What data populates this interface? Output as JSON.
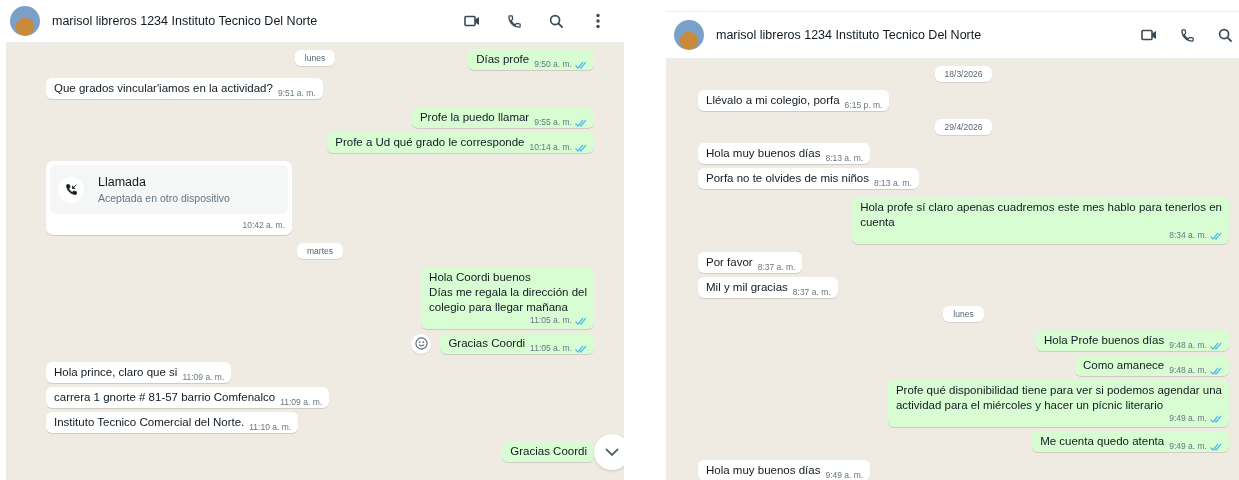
{
  "panels": [
    {
      "contact": {
        "name": "marisol libreros 1234 Instituto Tecnico Del Norte"
      },
      "actions": [
        {
          "kind": "video"
        },
        {
          "kind": "phone"
        },
        {
          "kind": "search"
        },
        {
          "kind": "menu"
        }
      ],
      "scroll_down_button": true,
      "items": [
        {
          "kind": "date",
          "text": "lunes",
          "sticky": true
        },
        {
          "kind": "sent",
          "text": "Días profe",
          "time": "9:50 a. m.",
          "read": true
        },
        {
          "kind": "received",
          "text": "Que grados vincular'iamos en la actividad?",
          "time": "9:51 a. m."
        },
        {
          "kind": "sent",
          "text": "Profe la puedo llamar",
          "time": "9:55 a. m.",
          "read": true
        },
        {
          "kind": "sent",
          "text": "Profe a Ud qué grado le corresponde",
          "time": "10:14 a. m.",
          "read": true
        },
        {
          "kind": "call",
          "title": "Llamada",
          "subtitle": "Aceptada en otro dispositivo",
          "time": "10:42 a. m."
        },
        {
          "kind": "date",
          "text": "martes",
          "sticky": false
        },
        {
          "kind": "sent",
          "text": "Hola Coordi buenos\nDías me regala la dirección del\ncolegio para llegar mañana",
          "time": "11:05 a. m.",
          "read": true
        },
        {
          "kind": "sent",
          "text": "Gracias Coordi",
          "time": "11:05 a. m.",
          "read": true,
          "reaction_button": true
        },
        {
          "kind": "received",
          "text": "Hola prince, claro que si",
          "time": "11:09 a. m."
        },
        {
          "kind": "received",
          "text": "carrera 1 gnorte # 81-57 barrio Comfenalco",
          "time": "11:09 a. m."
        },
        {
          "kind": "received",
          "text": "Instituto Tecnico Comercial del Norte.",
          "time": "11:10 a. m."
        },
        {
          "kind": "sent",
          "text": "Gracias Coordi"
        }
      ]
    },
    {
      "contact": {
        "name": "marisol libreros 1234 Instituto Tecnico Del Norte"
      },
      "actions": [
        {
          "kind": "video"
        },
        {
          "kind": "phone"
        },
        {
          "kind": "search"
        }
      ],
      "items": [
        {
          "kind": "date",
          "text": "18/3/2026",
          "sticky": false
        },
        {
          "kind": "received",
          "text": "Llévalo a mi colegio, porfa",
          "time": "6:15 p. m."
        },
        {
          "kind": "date",
          "text": "29/4/2026",
          "sticky": false
        },
        {
          "kind": "received",
          "text": "Hola muy buenos días",
          "time": "8:13 a. m."
        },
        {
          "kind": "received",
          "text": "Porfa no te olvides de mis niños",
          "time": "8:13 a. m."
        },
        {
          "kind": "sent",
          "text": "Hola profe sí claro apenas cuadremos este mes hablo para tenerlos en\ncuenta",
          "time": "8:34 a. m.",
          "read": true
        },
        {
          "kind": "received",
          "text": "Por favor",
          "time": "8:37 a. m."
        },
        {
          "kind": "received",
          "text": "Mil y mil gracias",
          "time": "8:37 a. m."
        },
        {
          "kind": "date",
          "text": "lunes",
          "sticky": false
        },
        {
          "kind": "sent",
          "text": "Hola Profe buenos días",
          "time": "9:48 a. m.",
          "read": true
        },
        {
          "kind": "sent",
          "text": "Como amanece",
          "time": "9:48 a. m.",
          "read": true
        },
        {
          "kind": "sent",
          "text": "Profe qué disponibilidad tiene para ver si podemos agendar una\nactividad para el miércoles y hacer un pícnic literario",
          "time": "9:49 a. m.",
          "read": true
        },
        {
          "kind": "sent",
          "text": "Me cuenta quedo atenta",
          "time": "9:49 a. m.",
          "read": true
        },
        {
          "kind": "received",
          "text": "Hola muy buenos días",
          "time": "9:49 a. m."
        }
      ]
    }
  ]
}
